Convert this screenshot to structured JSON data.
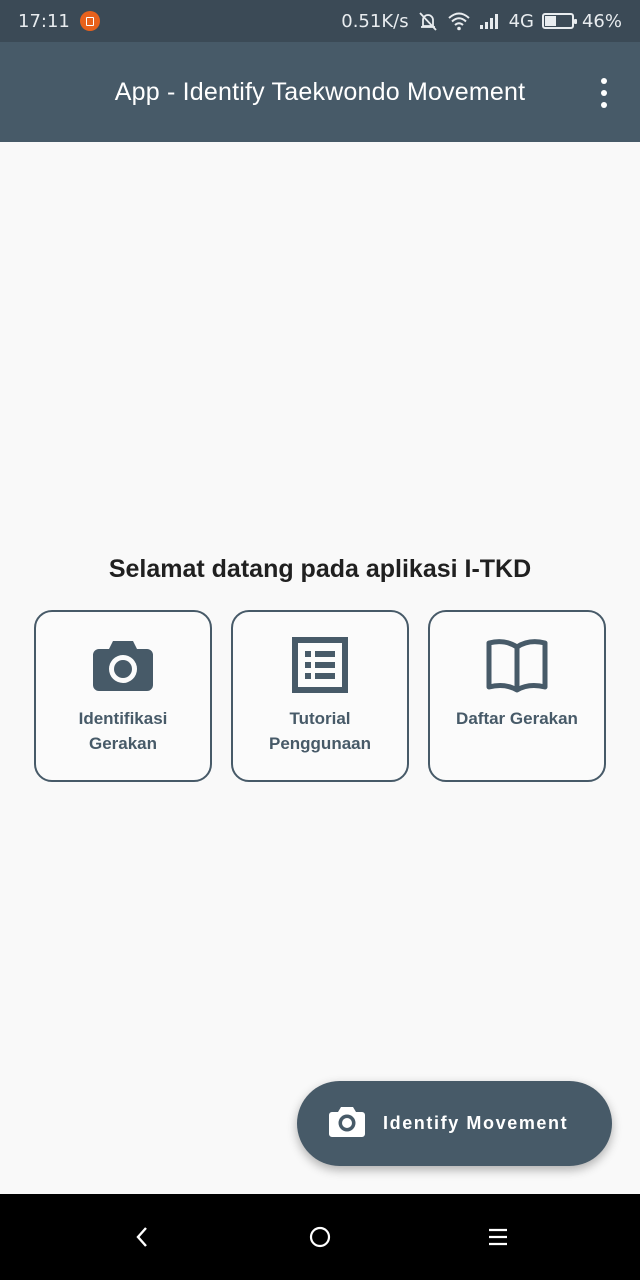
{
  "status_bar": {
    "time": "17:11",
    "net_speed": "0.51K/s",
    "network": "4G",
    "battery": "46%",
    "battery_level": 0.46
  },
  "app_bar": {
    "title": "App - Identify Taekwondo Movement",
    "more_icon": "more-vert-icon"
  },
  "welcome_text": "Selamat datang pada aplikasi I-TKD",
  "cards": [
    {
      "label": "Identifikasi Gerakan",
      "icon": "camera-icon"
    },
    {
      "label": "Tutorial Penggunaan",
      "icon": "list-icon"
    },
    {
      "label": "Daftar Gerakan",
      "icon": "book-icon"
    }
  ],
  "fab": {
    "label": "Identify Movement",
    "icon": "camera-icon"
  },
  "nav": {
    "back": "back-icon",
    "home": "home-icon",
    "menu": "menu-icon"
  },
  "colors": {
    "primary": "#475a68",
    "status_bar": "#3b4a56",
    "background": "#f9f9f9",
    "notification": "#e8611c"
  }
}
